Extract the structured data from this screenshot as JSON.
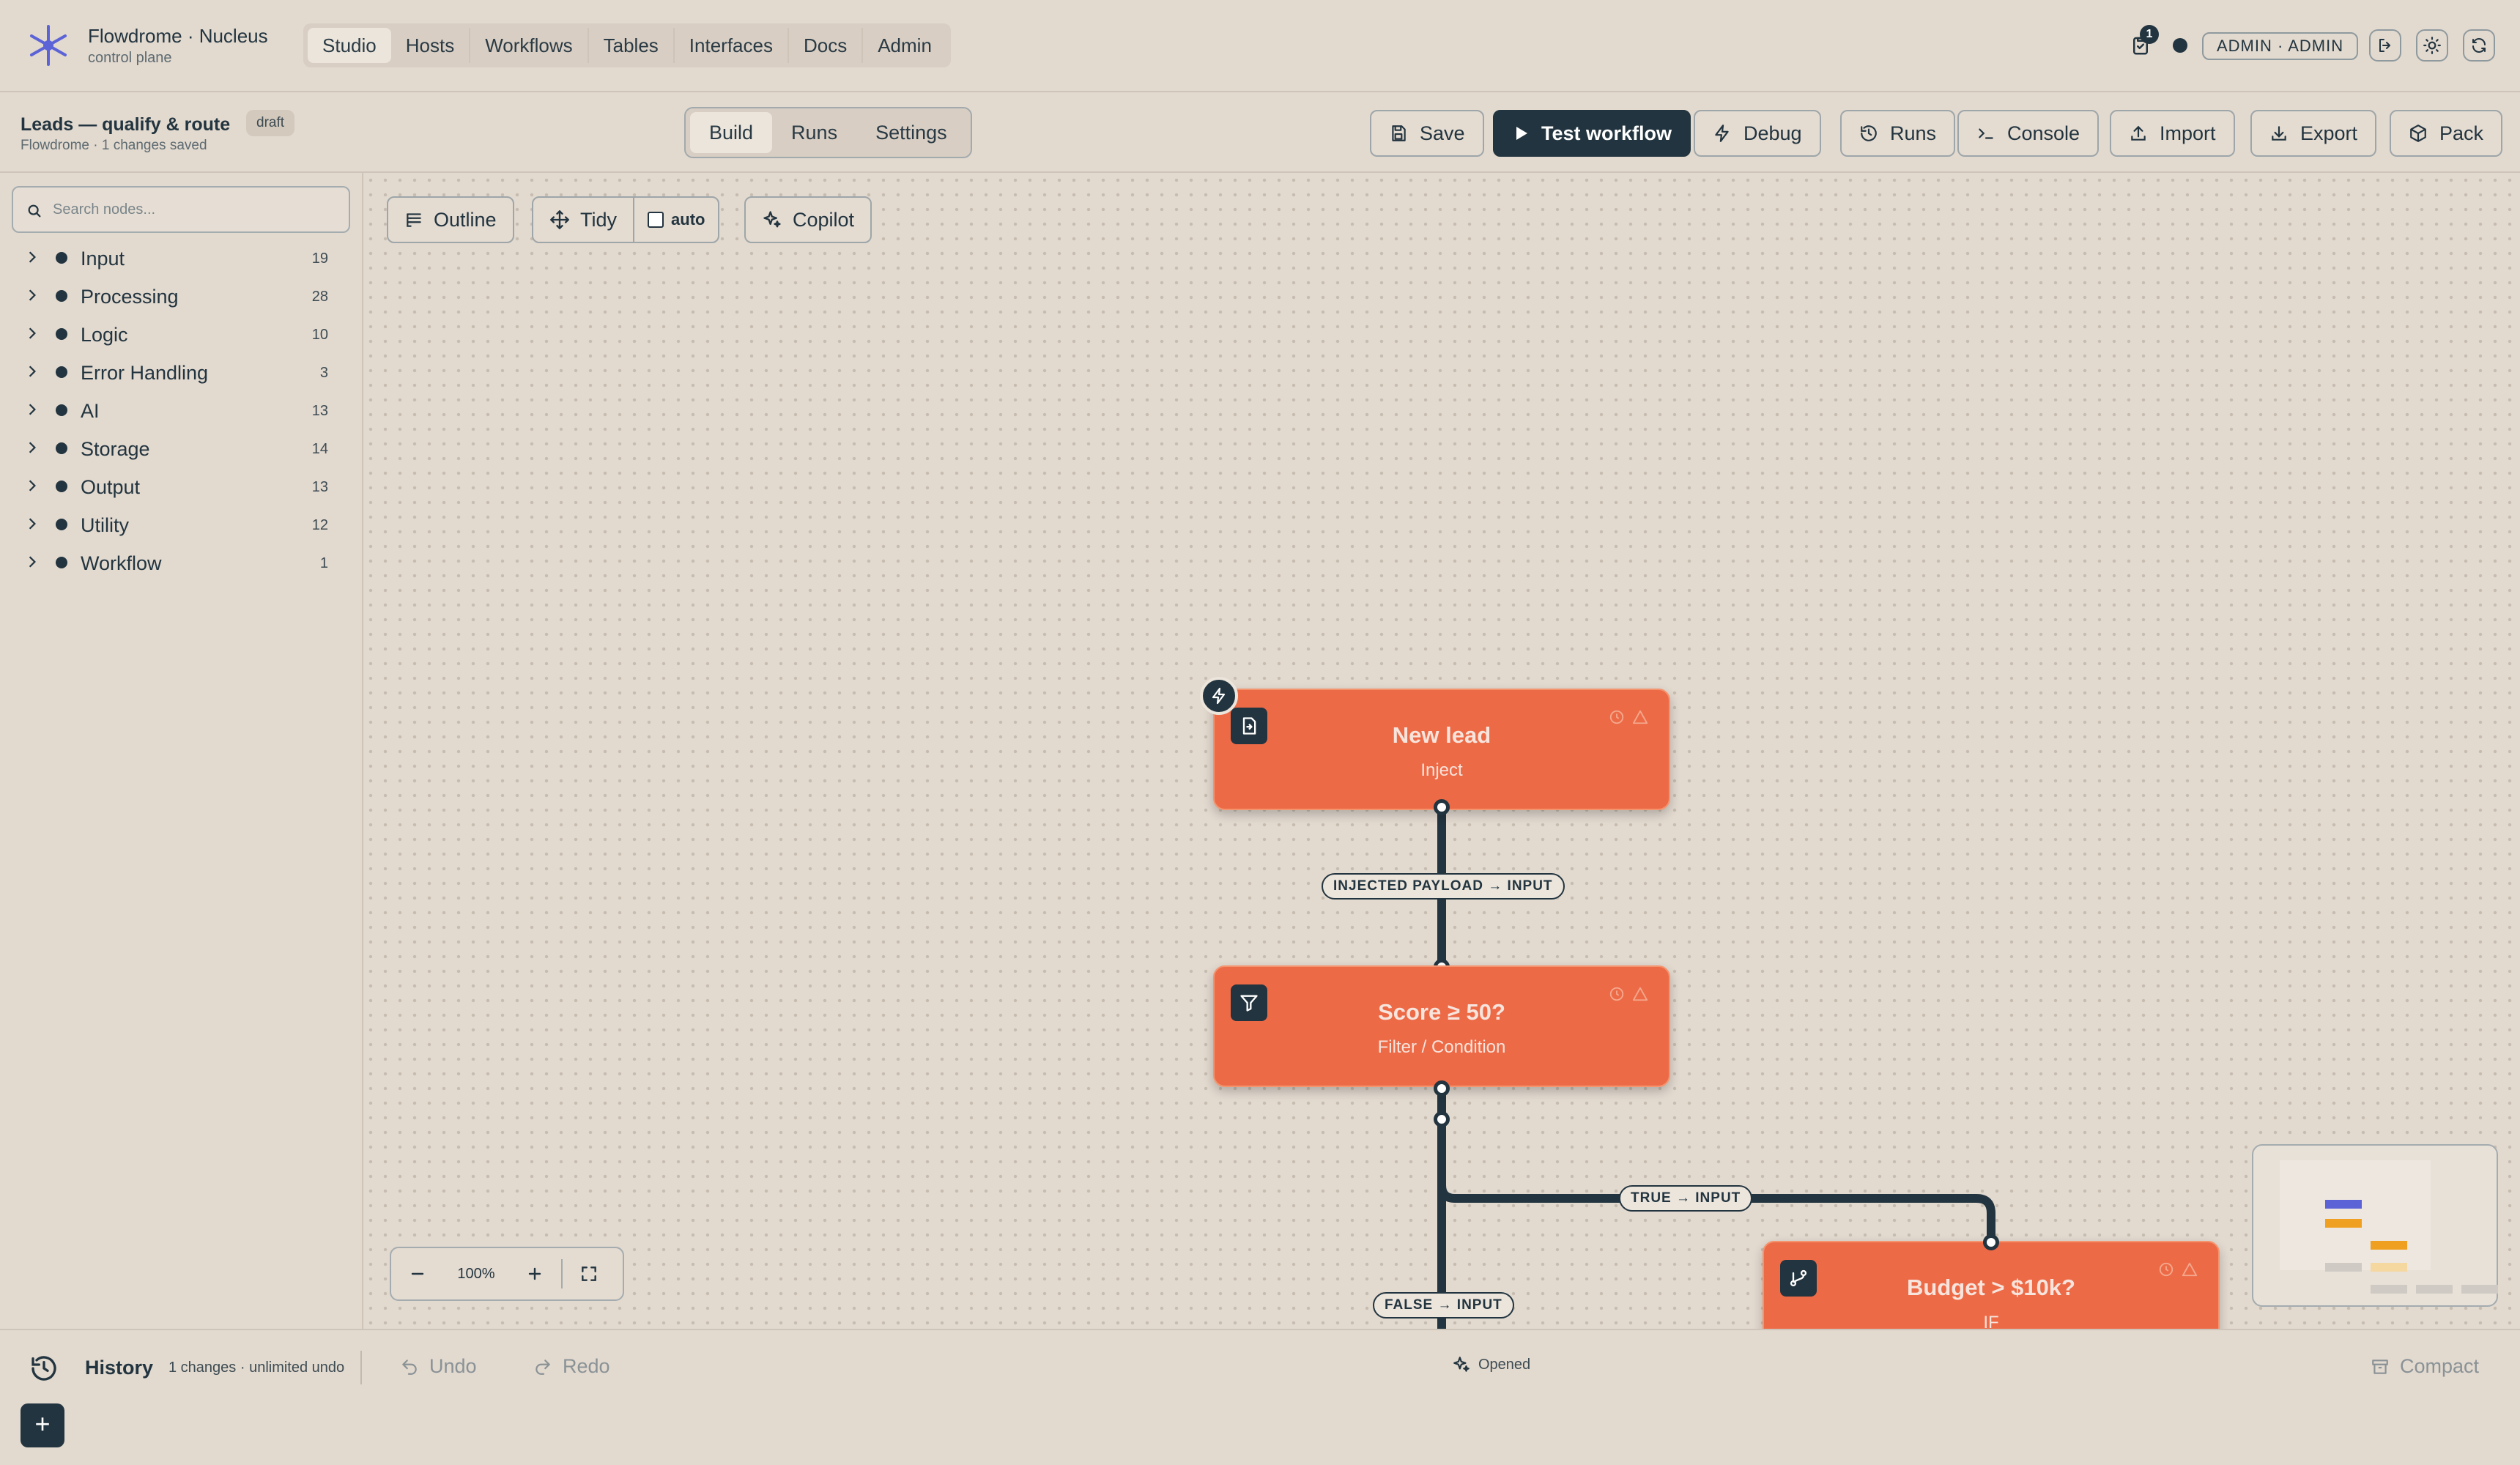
{
  "app": {
    "title": "Flowdrome · Nucleus",
    "subtitle": "control plane"
  },
  "nav": {
    "tabs": [
      "Studio",
      "Hosts",
      "Workflows",
      "Tables",
      "Interfaces",
      "Docs",
      "Admin"
    ],
    "active": "Studio"
  },
  "header": {
    "notification_count": "1",
    "user": "ADMIN · ADMIN"
  },
  "workflow": {
    "title": "Leads — qualify & route",
    "badge": "draft",
    "subtitle": "Flowdrome · 1 changes saved"
  },
  "modes": {
    "tabs": [
      "Build",
      "Runs",
      "Settings"
    ],
    "active": "Build"
  },
  "toolbar": {
    "save": "Save",
    "test": "Test workflow",
    "debug": "Debug",
    "runs": "Runs",
    "console": "Console",
    "import": "Import",
    "export": "Export",
    "pack": "Pack"
  },
  "sidebar": {
    "search_placeholder": "Search nodes...",
    "categories": [
      {
        "label": "Input",
        "count": "19"
      },
      {
        "label": "Processing",
        "count": "28"
      },
      {
        "label": "Logic",
        "count": "10"
      },
      {
        "label": "Error Handling",
        "count": "3"
      },
      {
        "label": "AI",
        "count": "13"
      },
      {
        "label": "Storage",
        "count": "14"
      },
      {
        "label": "Output",
        "count": "13"
      },
      {
        "label": "Utility",
        "count": "12"
      },
      {
        "label": "Workflow",
        "count": "1"
      }
    ]
  },
  "canvas": {
    "outline": "Outline",
    "tidy": "Tidy",
    "auto": "auto",
    "copilot": "Copilot",
    "zoom": "100%",
    "nodes": [
      {
        "title": "New lead",
        "subtitle": "Inject"
      },
      {
        "title": "Score ≥ 50?",
        "subtitle": "Filter / Condition"
      },
      {
        "title": "Budget > $10k?",
        "subtitle": "IF"
      }
    ],
    "edge_labels": [
      "INJECTED PAYLOAD → INPUT",
      "TRUE → INPUT",
      "FALSE → INPUT"
    ]
  },
  "colors": {
    "node": "#ed6a47",
    "ink": "#22343f",
    "background": "#e2d9cf"
  },
  "history": {
    "title": "History",
    "subtitle": "1 changes · unlimited undo",
    "undo": "Undo",
    "redo": "Redo",
    "status": "Opened",
    "compact": "Compact"
  }
}
